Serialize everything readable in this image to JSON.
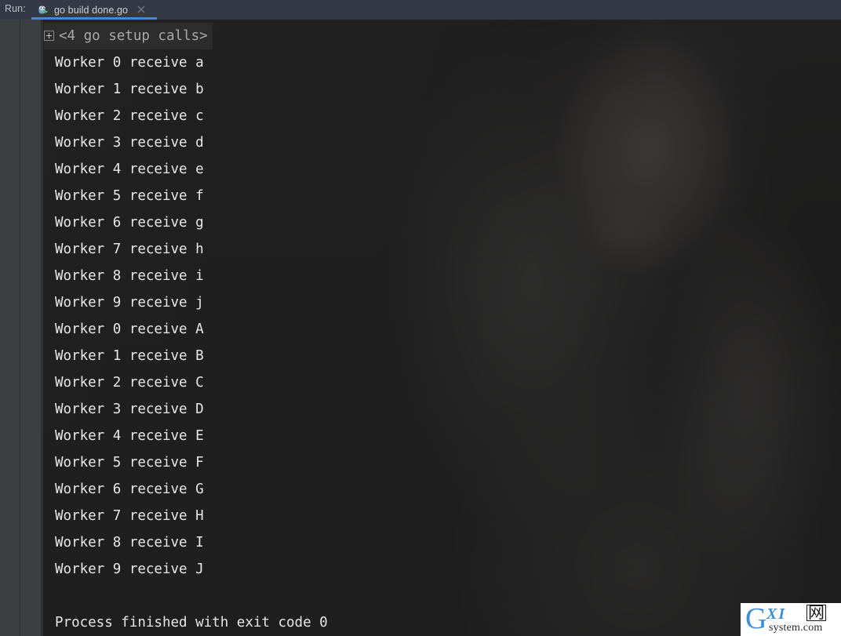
{
  "window": {
    "tool_window_label": "Run:",
    "accent_color": "#4a88c7",
    "console_bg": "#262626",
    "toolbar_bg": "#3c3f41",
    "topbar_bg": "#333a45"
  },
  "tabs": [
    {
      "label": "go build done.go",
      "icon": "go-gopher-icon",
      "close_icon": "close-icon",
      "active": true
    }
  ],
  "left_toolbar": {
    "primary": [
      {
        "name": "rerun-button",
        "icon": "run-triangle-icon",
        "color": "#59a869"
      },
      {
        "name": "settings-button",
        "icon": "wrench-icon",
        "color": "#aeb3b7"
      },
      {
        "name": "stop-button",
        "icon": "stop-square-icon",
        "color": "#707070"
      },
      {
        "name": "layout-button",
        "icon": "layout-grid-icon",
        "color": "#aeb3b7"
      },
      {
        "name": "pin-tab-button",
        "icon": "pin-icon",
        "color": "#aeb3b7"
      }
    ],
    "secondary": [
      {
        "name": "up-button",
        "icon": "arrow-up-icon",
        "color": "#8d9194",
        "selected": false
      },
      {
        "name": "down-button",
        "icon": "arrow-down-icon",
        "color": "#8d9194",
        "selected": false
      },
      {
        "name": "soft-wrap-button",
        "icon": "soft-wrap-icon",
        "color": "#aeb3b7",
        "selected": false
      },
      {
        "name": "scroll-to-end-button",
        "icon": "scroll-to-end-icon",
        "color": "#c3c7ca",
        "selected": true
      },
      {
        "name": "print-button",
        "icon": "printer-icon",
        "color": "#aeb3b7",
        "selected": false
      },
      {
        "name": "clear-all-button",
        "icon": "trash-icon",
        "color": "#aeb3b7",
        "selected": false
      }
    ]
  },
  "console": {
    "fold_marker": "+",
    "folded_header": "<4 go setup calls>",
    "lines": [
      "Worker 0 receive a",
      "Worker 1 receive b",
      "Worker 2 receive c",
      "Worker 3 receive d",
      "Worker 4 receive e",
      "Worker 5 receive f",
      "Worker 6 receive g",
      "Worker 7 receive h",
      "Worker 8 receive i",
      "Worker 9 receive j",
      "Worker 0 receive A",
      "Worker 1 receive B",
      "Worker 2 receive C",
      "Worker 3 receive D",
      "Worker 4 receive E",
      "Worker 5 receive F",
      "Worker 6 receive G",
      "Worker 7 receive H",
      "Worker 8 receive I",
      "Worker 9 receive J",
      "",
      "Process finished with exit code 0"
    ]
  },
  "watermark": {
    "letter": "G",
    "mid": "XI",
    "cjk": "网",
    "domain": "system.com"
  }
}
